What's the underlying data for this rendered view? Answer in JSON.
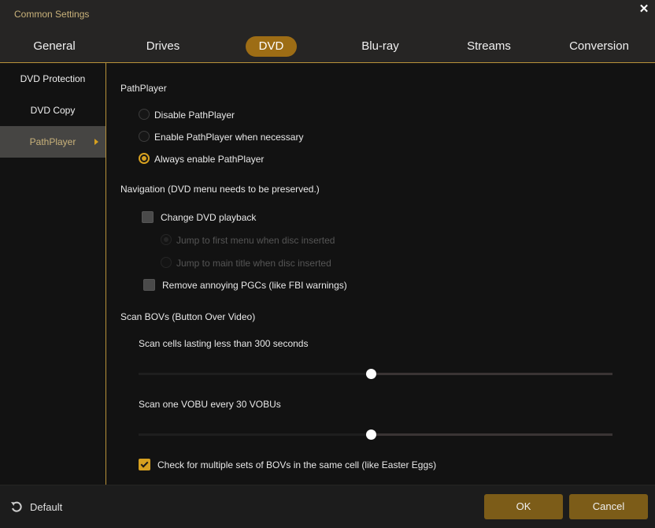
{
  "window": {
    "title": "Common Settings",
    "close_icon": "close-icon"
  },
  "tabs": [
    {
      "label": "General",
      "active": false
    },
    {
      "label": "Drives",
      "active": false
    },
    {
      "label": "DVD",
      "active": true
    },
    {
      "label": "Blu-ray",
      "active": false
    },
    {
      "label": "Streams",
      "active": false
    },
    {
      "label": "Conversion",
      "active": false
    }
  ],
  "sidebar": {
    "items": [
      {
        "label": "DVD Protection",
        "active": false
      },
      {
        "label": "DVD Copy",
        "active": false
      },
      {
        "label": "PathPlayer",
        "active": true
      }
    ]
  },
  "pathplayer": {
    "heading": "PathPlayer",
    "options": [
      {
        "label": "Disable PathPlayer",
        "selected": false
      },
      {
        "label": "Enable PathPlayer when necessary",
        "selected": false
      },
      {
        "label": "Always enable PathPlayer",
        "selected": true
      }
    ]
  },
  "navigation": {
    "heading": "Navigation (DVD menu needs to be preserved.)",
    "change_playback": {
      "label": "Change DVD playback",
      "checked": false
    },
    "sub_options": [
      {
        "label": "Jump to first menu when disc inserted",
        "selected": true,
        "disabled": true
      },
      {
        "label": "Jump to main title when disc inserted",
        "selected": false,
        "disabled": true
      }
    ],
    "remove_pgcs": {
      "label": "Remove annoying PGCs (like FBI warnings)",
      "checked": false
    }
  },
  "scan_bovs": {
    "heading": "Scan BOVs (Button Over Video)",
    "cells_slider": {
      "label": "Scan cells lasting less than 300 seconds",
      "value": 300,
      "fraction": 0.49
    },
    "vobu_slider": {
      "label": "Scan one VOBU every 30 VOBUs",
      "value": 30,
      "fraction": 0.49
    },
    "multiple_sets": {
      "label": "Check for multiple sets of BOVs in the same cell (like Easter Eggs)",
      "checked": true
    }
  },
  "footer": {
    "default_label": "Default",
    "default_icon": "reset-icon",
    "ok_label": "OK",
    "cancel_label": "Cancel"
  },
  "colors": {
    "accent": "#d6a020",
    "tab_active": "#9d6d15",
    "button": "#7c5c18",
    "title": "#c9b27a"
  }
}
